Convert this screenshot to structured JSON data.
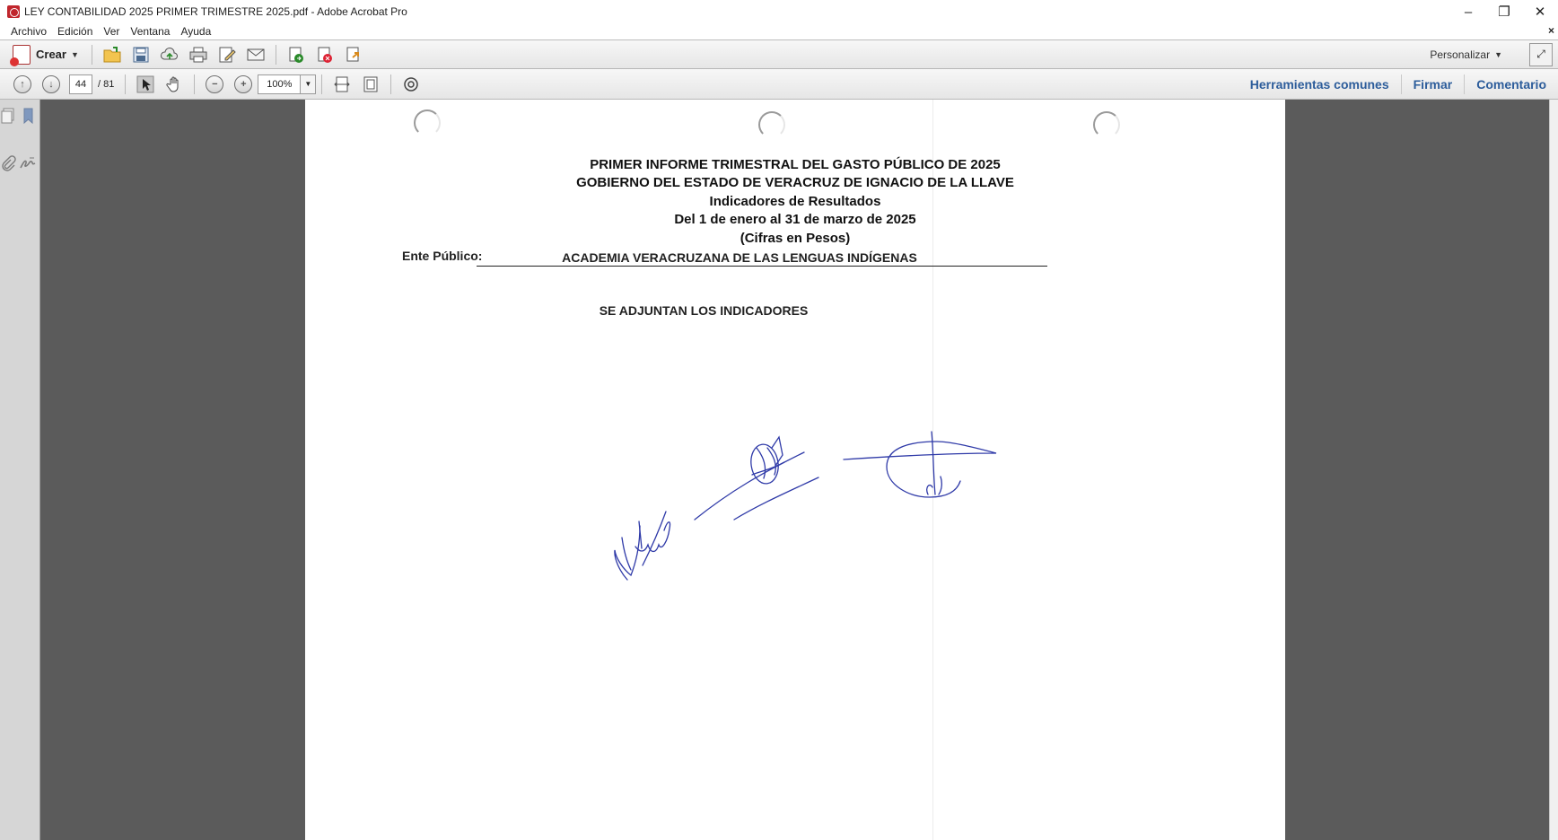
{
  "window": {
    "title": "LEY CONTABILIDAD 2025 PRIMER TRIMESTRE 2025.pdf - Adobe Acrobat Pro",
    "minimize": "–",
    "restore": "❐",
    "close": "✕"
  },
  "menu": {
    "items": [
      "Archivo",
      "Edición",
      "Ver",
      "Ventana",
      "Ayuda"
    ],
    "close_doc": "×"
  },
  "toolbar": {
    "crear_label": "Crear",
    "personalizar_label": "Personalizar"
  },
  "nav": {
    "current_page": "44",
    "total_pages": "/ 81",
    "zoom": "100%"
  },
  "right_panel": {
    "tools": "Herramientas comunes",
    "sign": "Firmar",
    "comment": "Comentario"
  },
  "document": {
    "line1": "PRIMER INFORME TRIMESTRAL DEL GASTO PÚBLICO DE 2025",
    "line2": "GOBIERNO DEL ESTADO DE VERACRUZ DE IGNACIO DE LA LLAVE",
    "line3": "Indicadores de Resultados",
    "line4": "Del 1 de enero al 31 de marzo de 2025",
    "line5": "(Cifras en Pesos)",
    "ente_label": "Ente Público:",
    "ente_value": "ACADEMIA VERACRUZANA DE LAS LENGUAS INDÍGENAS",
    "note": "SE ADJUNTAN LOS INDICADORES"
  },
  "colors": {
    "link": "#2d5d9b",
    "signature_ink": "#2f3aa8",
    "doc_background": "#5b5b5b"
  }
}
